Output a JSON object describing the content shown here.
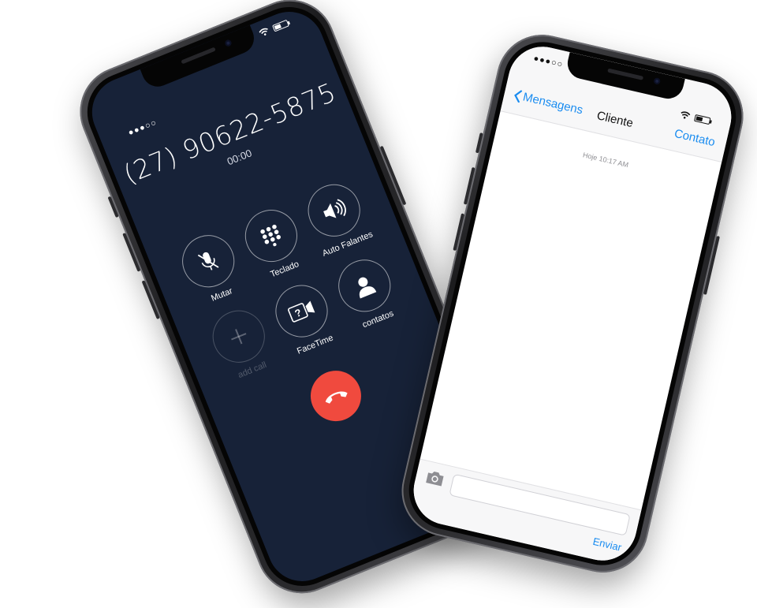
{
  "call_screen": {
    "status_signal": "●●●○○",
    "number": "(27) 90622-5875",
    "timer": "00:00",
    "controls": [
      {
        "label": "Mutar",
        "icon": "mic-off-icon"
      },
      {
        "label": "Teclado",
        "icon": "keypad-icon"
      },
      {
        "label": "Auto Falantes",
        "icon": "speaker-icon"
      },
      {
        "label": "add call",
        "icon": "plus-icon",
        "disabled": true
      },
      {
        "label": "FaceTime",
        "icon": "facetime-icon"
      },
      {
        "label": "contatos",
        "icon": "contact-icon"
      }
    ],
    "end_call_icon": "phone-hangup-icon",
    "colors": {
      "background": "#172238",
      "end_call": "#f04a3e"
    }
  },
  "messages_screen": {
    "status_signal": "●●●○○",
    "back_label": "Mensagens",
    "title": "Cliente",
    "action_label": "Contato",
    "timestamp": "Hoje 10:17 AM",
    "send_label": "Enviar",
    "input_placeholder": "",
    "colors": {
      "accent": "#1a8cf0"
    }
  }
}
